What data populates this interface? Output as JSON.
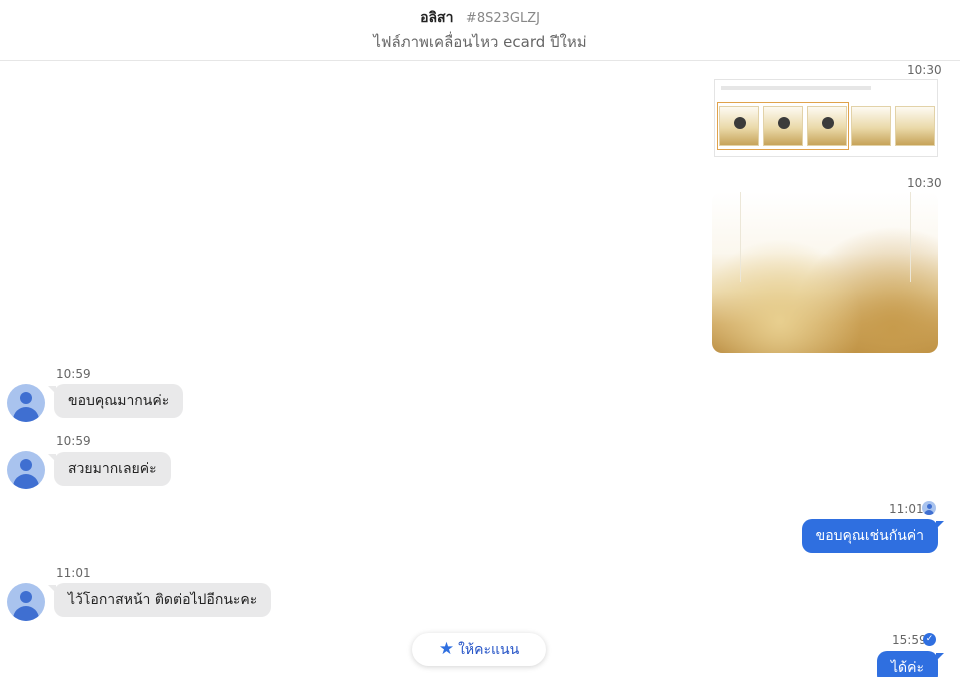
{
  "header": {
    "name": "อลิสา",
    "order_code": "#8S23GLZJ",
    "subtitle": "ไฟล์ภาพเคลื่อนไหว ecard ปีใหม่"
  },
  "messages": [
    {
      "direction": "out",
      "type": "image",
      "time": "10:30"
    },
    {
      "direction": "out",
      "type": "image",
      "time": "10:30"
    },
    {
      "direction": "in",
      "type": "text",
      "time": "10:59",
      "text": "ขอบคุณมากนค่ะ"
    },
    {
      "direction": "in",
      "type": "text",
      "time": "10:59",
      "text": "สวยมากเลยค่ะ"
    },
    {
      "direction": "out",
      "type": "text",
      "time": "11:01",
      "text": "ขอบคุณเช่นกันค่า",
      "status": "read"
    },
    {
      "direction": "in",
      "type": "text",
      "time": "11:01",
      "text": "ไว้โอกาสหน้า ติดต่อไปอีกนะคะ"
    },
    {
      "direction": "out",
      "type": "text",
      "time": "15:59",
      "text": "ได้ค่ะ",
      "status": "sent"
    }
  ],
  "rating_button": {
    "label": "ให้คะแนน",
    "icon": "star-icon"
  },
  "colors": {
    "accent": "#2f6fe0",
    "incoming_bubble": "#e9e9ea",
    "header_border": "#e6e6e6"
  }
}
